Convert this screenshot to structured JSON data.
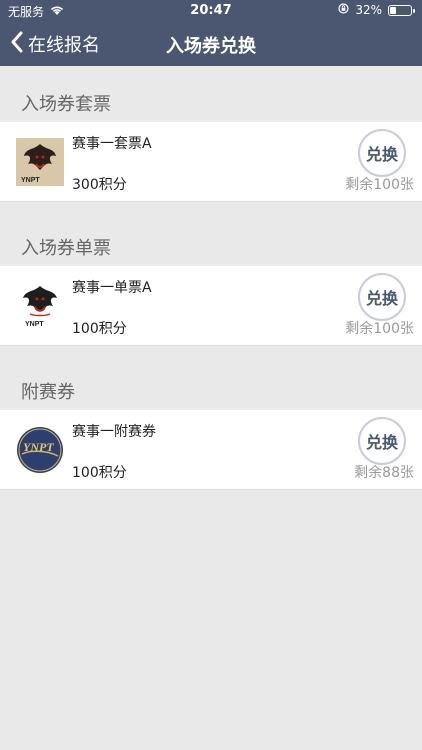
{
  "status_bar": {
    "carrier": "无服务",
    "time": "20:47",
    "battery_text": "32%",
    "battery_level": 0.32
  },
  "nav": {
    "back_label": "在线报名",
    "title": "入场券兑换"
  },
  "sections": [
    {
      "title": "入场券套票",
      "items": [
        {
          "name": "赛事一套票A",
          "points": "300积分",
          "button": "兑换",
          "remaining": "剩余100张",
          "icon": "phoenix-logo-icon"
        }
      ]
    },
    {
      "title": "入场券单票",
      "items": [
        {
          "name": "赛事一单票A",
          "points": "100积分",
          "button": "兑换",
          "remaining": "剩余100张",
          "icon": "phoenix-logo-icon"
        }
      ]
    },
    {
      "title": "附赛券",
      "items": [
        {
          "name": "赛事一附赛券",
          "points": "100积分",
          "button": "兑换",
          "remaining": "剩余88张",
          "icon": "ynpt-logo-icon"
        }
      ]
    }
  ],
  "logo_text": "YNPT",
  "colors": {
    "header_bg": "#4b5670",
    "page_bg": "#e9e9e9",
    "accent": "#4b5670"
  }
}
